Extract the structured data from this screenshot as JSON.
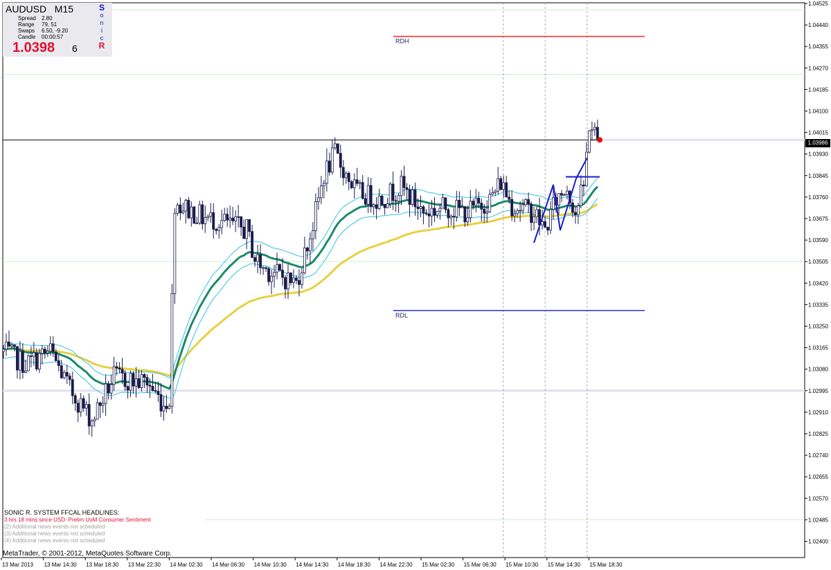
{
  "window": {
    "symbol": "AUDUSD",
    "timeframe": "M15",
    "copyright": "MetaTrader, © 2001-2012, MetaQuotes Software Corp."
  },
  "info_panel": {
    "rows": [
      {
        "key": "Spread",
        "value": "2.80"
      },
      {
        "key": "Range",
        "value": "79, 51"
      },
      {
        "key": "Swaps",
        "value": "6.50, -9.20"
      },
      {
        "key": "Candle",
        "value": "00:00:57"
      }
    ],
    "price_main": "1.0398",
    "price_last_digit": "6",
    "brand_letters": [
      "S",
      "o",
      "n",
      "i",
      "c",
      "R"
    ],
    "brand_colors": [
      "#1010d0",
      "#1010d0",
      "#1010d0",
      "#1010d0",
      "#1010d0",
      "#e01030"
    ]
  },
  "news": {
    "title": "SONIC R. SYSTEM  FFCAL HEADLINES:",
    "lines": [
      {
        "text": "3 hrs 18 mins since USD: Prelim UoM Consumer Sentiment",
        "color": "#e01030"
      },
      {
        "text": "(2)  Additional news events not scheduled",
        "color": "#a0a0a0"
      },
      {
        "text": "(3)  Additional news events not scheduled",
        "color": "#a0a0a0"
      },
      {
        "text": "(4)  Additional news events not scheduled",
        "color": "#a0a0a0"
      }
    ]
  },
  "colors": {
    "candle": "#1a1a4a",
    "ema_fast": "#1a8a6a",
    "ema_band": "#30c0e8",
    "ema_slow": "#e8d040",
    "rdh": "#ff2020",
    "rdl": "#2030d0",
    "grid_green": "#c8f0c8",
    "grid_lavender": "#e0e0f0",
    "price_line": "#000000",
    "marker": "#e01010",
    "pattern": "#1a1ad0"
  },
  "chart_data": {
    "type": "candlestick",
    "symbol": "AUDUSD",
    "timeframe": "M15",
    "y_ticks": [
      "1.04525",
      "1.04440",
      "1.04355",
      "1.04270",
      "1.04185",
      "1.04100",
      "1.04015",
      "1.03930",
      "1.03845",
      "1.03760",
      "1.03675",
      "1.03590",
      "1.03505",
      "1.03420",
      "1.03335",
      "1.03250",
      "1.03165",
      "1.03080",
      "1.02995",
      "1.02910",
      "1.02825",
      "1.02740",
      "1.02655",
      "1.02570",
      "1.02485",
      "1.02400"
    ],
    "ylim": [
      1.024,
      1.04525
    ],
    "x_ticks": [
      "13 Mar 2013",
      "13 Mar 14:30",
      "13 Mar 18:30",
      "13 Mar 22:30",
      "14 Mar 02:30",
      "14 Mar 06:30",
      "14 Mar 10:30",
      "14 Mar 14:30",
      "14 Mar 18:30",
      "14 Mar 22:30",
      "15 Mar 02:30",
      "15 Mar 06:30",
      "15 Mar 10:30",
      "15 Mar 14:30",
      "15 Mar 18:30"
    ],
    "current_price": "1.03986",
    "current_value": 1.03986,
    "levels": [
      {
        "name": "RDH",
        "value": 1.04395
      },
      {
        "name": "RDL",
        "value": 1.03312
      }
    ],
    "horizontal_lines": [
      1.045,
      1.04245,
      1.03505,
      1.02995,
      1.02485
    ],
    "vertical_lines": [
      "15 Mar 06:30",
      "15 Mar 10:30",
      "15 Mar 14:30"
    ],
    "anchors": [
      {
        "t": 0,
        "v": 1.0315
      },
      {
        "t": 8,
        "v": 1.031
      },
      {
        "t": 17,
        "v": 1.0315
      },
      {
        "t": 24,
        "v": 1.03
      },
      {
        "t": 32,
        "v": 1.0288
      },
      {
        "t": 40,
        "v": 1.0305
      },
      {
        "t": 48,
        "v": 1.0303
      },
      {
        "t": 52,
        "v": 1.0303
      },
      {
        "t": 58,
        "v": 1.0294
      },
      {
        "t": 60,
        "v": 1.0297
      },
      {
        "t": 62,
        "v": 1.0374
      },
      {
        "t": 72,
        "v": 1.0368
      },
      {
        "t": 80,
        "v": 1.0366
      },
      {
        "t": 88,
        "v": 1.0363
      },
      {
        "t": 91,
        "v": 1.0352
      },
      {
        "t": 94,
        "v": 1.0348
      },
      {
        "t": 100,
        "v": 1.0345
      },
      {
        "t": 106,
        "v": 1.0342
      },
      {
        "t": 112,
        "v": 1.0365
      },
      {
        "t": 116,
        "v": 1.0385
      },
      {
        "t": 120,
        "v": 1.0393
      },
      {
        "t": 124,
        "v": 1.0385
      },
      {
        "t": 128,
        "v": 1.0378
      },
      {
        "t": 136,
        "v": 1.0375
      },
      {
        "t": 144,
        "v": 1.038
      },
      {
        "t": 152,
        "v": 1.037
      },
      {
        "t": 160,
        "v": 1.0372
      },
      {
        "t": 168,
        "v": 1.037
      },
      {
        "t": 176,
        "v": 1.0375
      },
      {
        "t": 180,
        "v": 1.0382
      },
      {
        "t": 184,
        "v": 1.0373
      },
      {
        "t": 192,
        "v": 1.037
      },
      {
        "t": 196,
        "v": 1.0363
      },
      {
        "t": 200,
        "v": 1.0375
      },
      {
        "t": 204,
        "v": 1.038
      },
      {
        "t": 207,
        "v": 1.037
      },
      {
        "t": 210,
        "v": 1.038
      },
      {
        "t": 212,
        "v": 1.0405
      },
      {
        "t": 215,
        "v": 1.0399
      }
    ]
  }
}
